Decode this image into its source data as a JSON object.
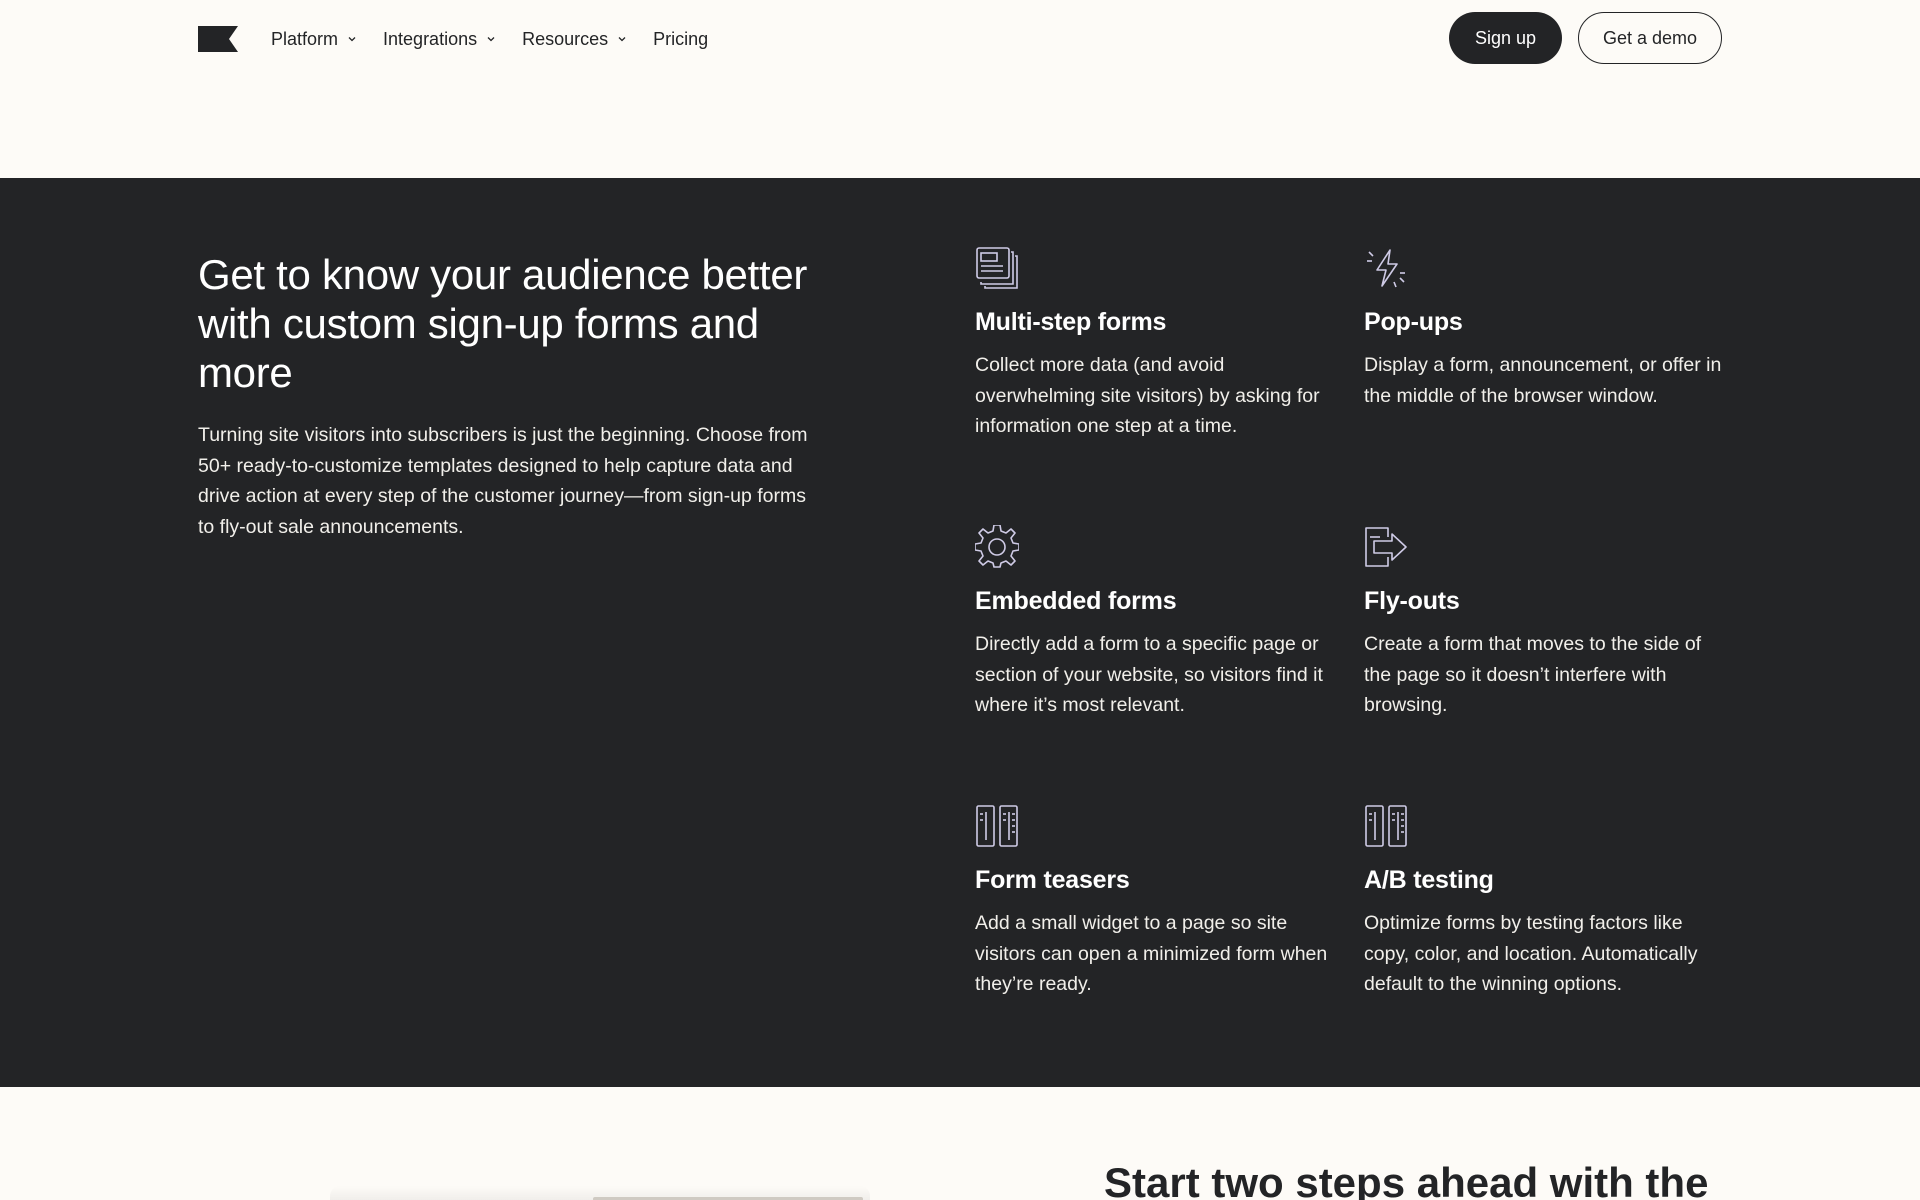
{
  "nav": {
    "logo_icon": "klaviyo-flag-logo",
    "items": [
      {
        "label": "Platform",
        "has_dropdown": true
      },
      {
        "label": "Integrations",
        "has_dropdown": true
      },
      {
        "label": "Resources",
        "has_dropdown": true
      },
      {
        "label": "Pricing",
        "has_dropdown": false
      }
    ],
    "signup_label": "Sign up",
    "demo_label": "Get a demo"
  },
  "hero": {
    "headline": "Get to know your audience better with custom sign-up forms and more",
    "body": "Turning site visitors into subscribers is just the beginning. Choose from 50+ ready-to-customize templates designed to help capture data and drive action at every step of the customer journey—from sign-up forms to fly-out sale announcements."
  },
  "features": [
    {
      "icon": "stacked-pages-icon",
      "title": "Multi-step forms",
      "body": "Collect more data (and avoid overwhelming site visitors) by asking for information one step at a time."
    },
    {
      "icon": "lightning-icon",
      "title": "Pop-ups",
      "body": "Display a form, announcement, or offer in the middle of the browser window."
    },
    {
      "icon": "gear-icon",
      "title": "Embedded forms",
      "body": "Directly add a form to a specific page or section of your website, so visitors find it where it’s most relevant."
    },
    {
      "icon": "arrow-right-box-icon",
      "title": "Fly-outs",
      "body": "Create a form that moves to the side of the page so it doesn’t interfere with browsing."
    },
    {
      "icon": "split-panels-icon",
      "title": "Form teasers",
      "body": "Add a small widget to a page so site visitors can open a minimized form when they’re ready."
    },
    {
      "icon": "split-panels-icon",
      "title": "A/B testing",
      "body": "Optimize forms by testing factors like copy, color, and location. Automatically default to the winning options."
    }
  ],
  "next_section": {
    "heading": "Start two steps ahead with the"
  },
  "colors": {
    "background": "#fdfbf7",
    "dark": "#232426",
    "text_light": "#ffffff"
  }
}
